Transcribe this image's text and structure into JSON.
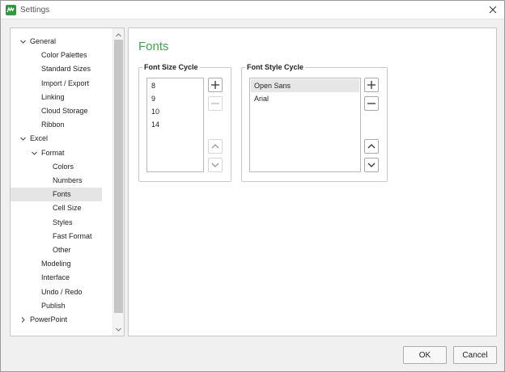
{
  "window": {
    "title": "Settings"
  },
  "tree": {
    "items": [
      {
        "label": "General",
        "chevron": "down",
        "level": 0
      },
      {
        "label": "Color Palettes",
        "level": 1
      },
      {
        "label": "Standard Sizes",
        "level": 1
      },
      {
        "label": "Import / Export",
        "level": 1
      },
      {
        "label": "Linking",
        "level": 1
      },
      {
        "label": "Cloud Storage",
        "level": 1
      },
      {
        "label": "Ribbon",
        "level": 1
      },
      {
        "label": "Excel",
        "chevron": "down",
        "level": 0
      },
      {
        "label": "Format",
        "chevron": "down",
        "level": 1
      },
      {
        "label": "Colors",
        "level": 2
      },
      {
        "label": "Numbers",
        "level": 2
      },
      {
        "label": "Fonts",
        "level": 2,
        "selected": true
      },
      {
        "label": "Cell Size",
        "level": 2
      },
      {
        "label": "Styles",
        "level": 2
      },
      {
        "label": "Fast Format",
        "level": 2
      },
      {
        "label": "Other",
        "level": 2
      },
      {
        "label": "Modeling",
        "level": 1
      },
      {
        "label": "Interface",
        "level": 1
      },
      {
        "label": "Undo / Redo",
        "level": 1
      },
      {
        "label": "Publish",
        "level": 1
      },
      {
        "label": "PowerPoint",
        "chevron": "right",
        "level": 0
      }
    ]
  },
  "content": {
    "title": "Fonts",
    "font_size_cycle": {
      "legend": "Font Size Cycle",
      "items": [
        "8",
        "9",
        "10",
        "14"
      ]
    },
    "font_style_cycle": {
      "legend": "Font Style Cycle",
      "items": [
        "Open Sans",
        "Arial"
      ],
      "selected_index": 0
    }
  },
  "footer": {
    "ok_label": "OK",
    "cancel_label": "Cancel"
  },
  "colors": {
    "accent": "#3fa24f",
    "app_icon": "#2e9a3f"
  }
}
